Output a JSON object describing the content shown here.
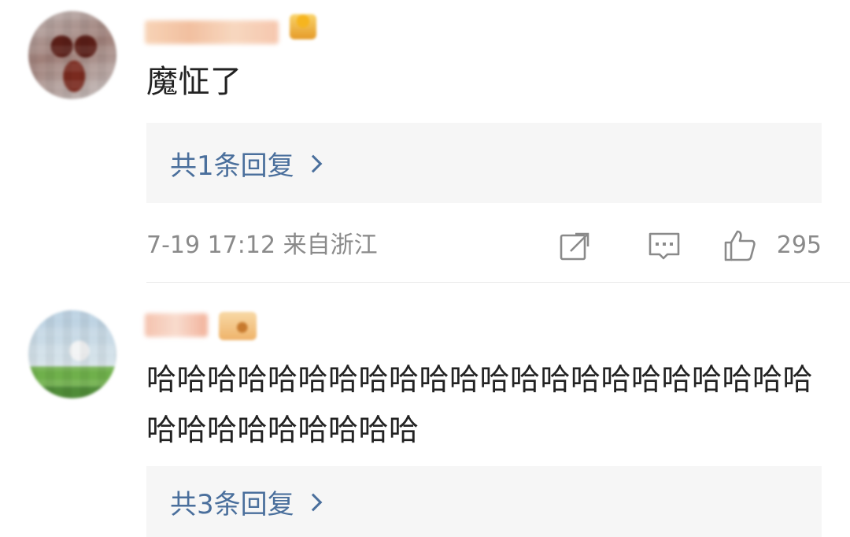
{
  "comments": [
    {
      "text": "魔怔了",
      "reply_label": "共1条回复",
      "timestamp": "7-19 17:12 来自浙江",
      "like_count": "295"
    },
    {
      "text": "哈哈哈哈哈哈哈哈哈哈哈哈哈哈哈哈哈哈哈哈哈哈哈哈哈哈哈哈哈哈哈",
      "reply_label": "共3条回复"
    }
  ],
  "icons": {
    "share": "share-icon",
    "comment": "comment-icon",
    "like": "thumbs-up-icon",
    "reply_arrow": "chevron-right-icon"
  },
  "colors": {
    "reply_link": "#4a6f9c",
    "meta_text": "#8a8a8a",
    "content_text": "#222222",
    "reply_bg": "#f6f6f6"
  }
}
